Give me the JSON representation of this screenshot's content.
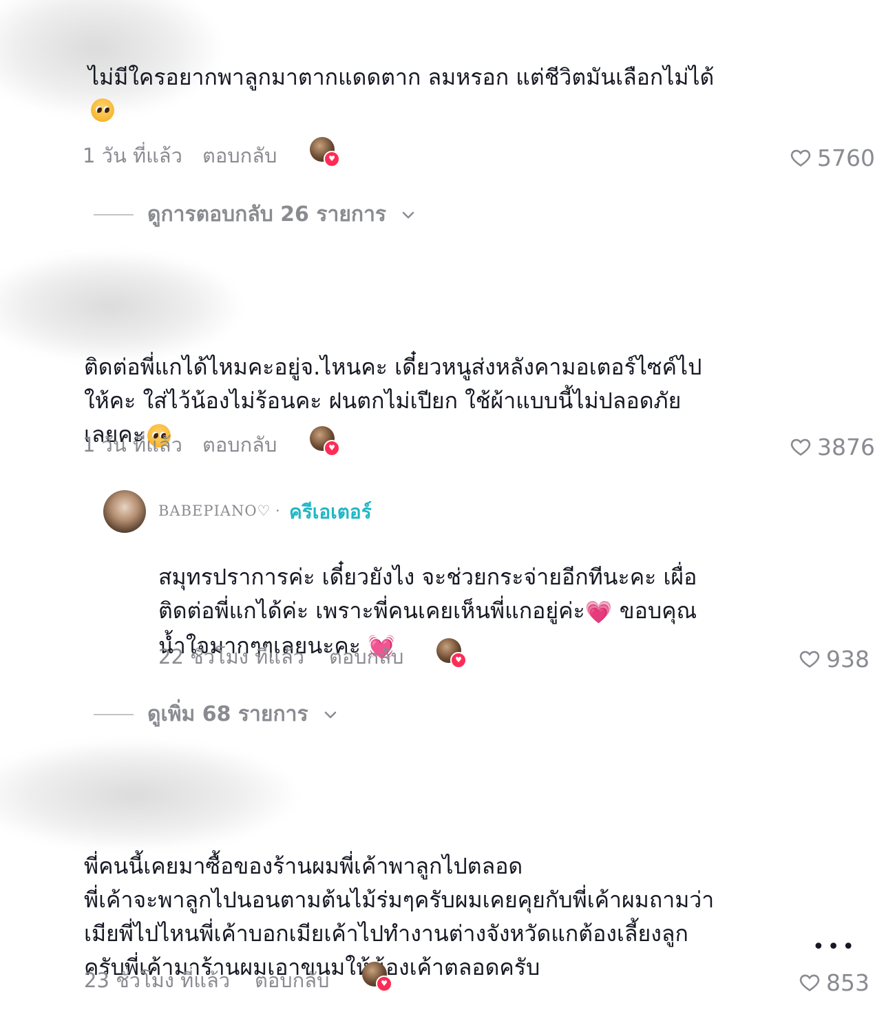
{
  "comments": [
    {
      "text": "ไม่มีใครอยากพาลูกมาตากแดดตาก ลมหรอก แต่ชีวิตมันเลือกไม่ได้",
      "time": "1 วัน ที่แล้ว",
      "reply_label": "ตอบกลับ",
      "likes": "5760",
      "view_replies": "ดูการตอบกลับ 26 รายการ"
    },
    {
      "text_lines": [
        "ติดต่อพี่แกได้ไหมคะอยู่จ.ไหนคะ เดี๋ยวหนูส่งหลังคามอเตอร์ไซค์ไป",
        "ให้คะ ใส่ไว้น้องไม่ร้อนคะ ฝนตกไม่เปียก ใช้ผ้าแบบนี้ไม่ปลอดภัย",
        "เลยคะ"
      ],
      "time": "1 วัน ที่แล้ว",
      "reply_label": "ตอบกลับ",
      "likes": "3876",
      "reply": {
        "username": "BABEPIANO♡",
        "separator": "·",
        "badge": "ครีเอเตอร์",
        "text_lines": [
          "สมุทรปราการค่ะ เดี๋ยวยังไง จะช่วยกระจ่ายอีกทีนะคะ เผื่อ",
          "ติดต่อพี่แกได้ค่ะ เพราะพี่คนเคยเห็นพี่แกอยู่ค่ะ",
          "ขอบคุณ",
          "น้ำใจมากๆๆเลยนะคะ"
        ],
        "time": "22 ชั่วโมง ที่แล้ว",
        "reply_label": "ตอบกลับ",
        "likes": "938"
      },
      "view_more": "ดูเพิ่ม 68 รายการ"
    },
    {
      "text_lines": [
        "พี่คนนี้เคยมาซื้อของร้านผมพี่เค้าพาลูกไปตลอด",
        "พี่เค้าจะพาลูกไปนอนตามต้นไม้ร่มๆครับผมเคยคุยกับพี่เค้าผมถามว่า",
        "เมียพี่ไปไหนพี่เค้าบอกเมียเค้าไปทำงานต่างจังหวัดแกต้องเลี้ยงลูก",
        "ครับพี่เค้ามาร้านผมเอาขนมให้น้องเค้าตลอดครับ"
      ],
      "time": "23 ชั่วโมง ที่แล้ว",
      "reply_label": "ตอบกลับ",
      "likes": "853",
      "more": "•••"
    }
  ],
  "icons": {
    "like": "heart-outline-icon",
    "chevron": "chevron-down-icon",
    "liked_by_creator": "creator-liked-avatar-icon"
  },
  "colors": {
    "text": "#161823",
    "meta": "#8a8b91",
    "creator_badge": "#20b7c4",
    "heart_badge": "#fe2c55"
  }
}
